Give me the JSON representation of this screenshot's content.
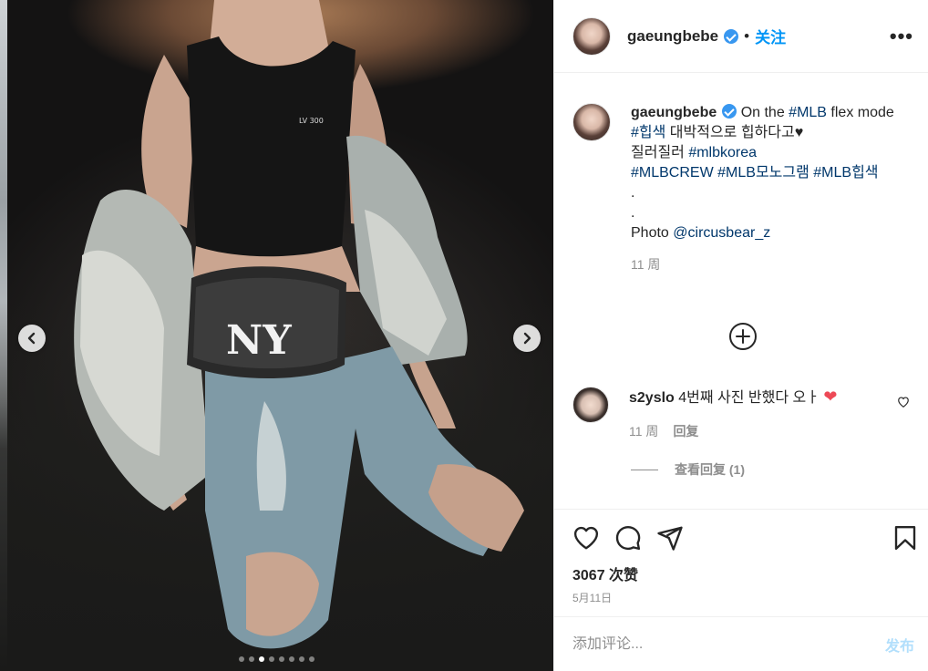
{
  "post": {
    "username": "gaeungbebe",
    "follow_label": "关注",
    "more_label": "•••",
    "dot": "•"
  },
  "caption": {
    "username": "gaeungbebe",
    "lead": "On the ",
    "line1_tag": "#MLB",
    "line1_rest": " flex mode",
    "line2_tag": "#힙색",
    "line2_rest": " 대박적으로 힙하다고",
    "line2_heart": "♥",
    "line3_text": "질러질러 ",
    "line3_tag": "#mlbkorea",
    "line4_tag1": "#MLBCREW",
    "line4_tag2": "#MLB모노그램",
    "line4_tag3": "#MLB힙색",
    "dot1": ".",
    "dot2": ".",
    "photo_label": "Photo ",
    "photo_mention": "@circusbear_z",
    "time": "11 周"
  },
  "reply": {
    "username": "s2yslo",
    "text": " 4번째 사진 반했다 오ㅏ ",
    "heart": "❤",
    "time": "11 周",
    "reply_label": "回复",
    "view_replies": "查看回复 (1)"
  },
  "stats": {
    "likes": "3067 次赞",
    "date": "5月11日"
  },
  "composer": {
    "placeholder": "添加评论...",
    "post_label": "发布"
  },
  "carousel": {
    "count": 8,
    "active_index": 2
  },
  "colors": {
    "link": "#0095f6",
    "hashtag": "#00376b",
    "verified": "#3897f0",
    "muted": "#8e8e8e",
    "post_disabled": "#b2dffc",
    "heart_red": "#ed4956"
  },
  "icons": [
    "chevron-left-icon",
    "chevron-right-icon",
    "verified-badge-icon",
    "more-icon",
    "add-circle-icon",
    "heart-outline-icon",
    "comment-icon",
    "share-icon",
    "bookmark-icon"
  ]
}
